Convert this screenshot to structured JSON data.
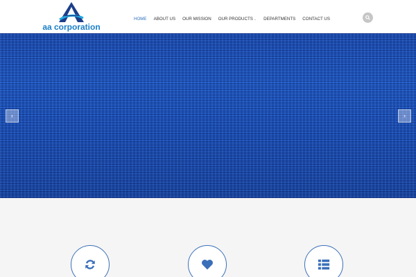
{
  "brand": {
    "name": "aa  corporation",
    "accent_color": "#1a7fc8",
    "logo_icon": "triangle-a-logo-icon"
  },
  "nav": {
    "items": [
      {
        "label": "HOME",
        "active": true
      },
      {
        "label": "ABOUT US",
        "active": false
      },
      {
        "label": "OUR MISSION",
        "active": false
      },
      {
        "label": "OUR PRODUCTS",
        "active": false,
        "has_dropdown": true
      },
      {
        "label": "DEPARTMENTS",
        "active": false
      },
      {
        "label": "CONTACT US",
        "active": false
      }
    ],
    "active_color": "#2a6fbb",
    "search_icon": "search-icon"
  },
  "hero": {
    "background_color": "#1e5bc9",
    "prev_arrow": "‹",
    "next_arrow": "›"
  },
  "features": {
    "background_color": "#f5f5f5",
    "circle_border_color": "#3a6fb9",
    "icons": [
      "refresh-icon",
      "heart-icon",
      "list-icon"
    ]
  }
}
